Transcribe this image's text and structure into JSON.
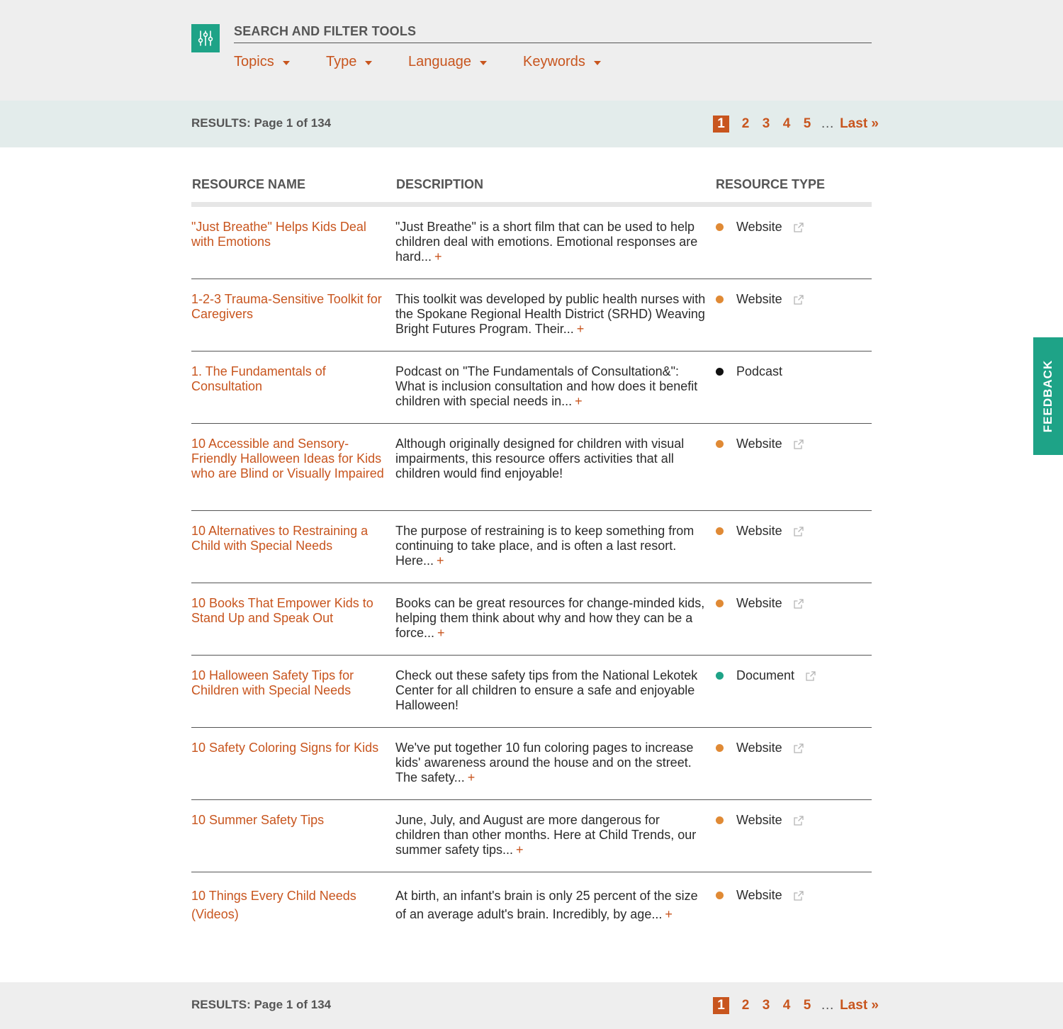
{
  "filters": {
    "heading": "SEARCH AND FILTER TOOLS",
    "menus": [
      {
        "label": "Topics"
      },
      {
        "label": "Type"
      },
      {
        "label": "Language"
      },
      {
        "label": "Keywords"
      }
    ]
  },
  "results": {
    "label": "RESULTS: Page 1 of 134",
    "pages": [
      "1",
      "2",
      "3",
      "4",
      "5"
    ],
    "current_page": "1",
    "ellipsis": "…",
    "last_label": "Last »"
  },
  "table": {
    "headers": {
      "name": "RESOURCE NAME",
      "description": "DESCRIPTION",
      "type": "RESOURCE TYPE"
    },
    "more_symbol": "+",
    "rows": [
      {
        "name": "\"Just Breathe\" Helps Kids Deal with Emotions",
        "description": "\"Just Breathe\" is a short film that can be used to help children deal with emotions. Emotional responses are hard...",
        "more": "+",
        "type": "Website",
        "dot_color": "#e08a35",
        "external": true
      },
      {
        "name": "1-2-3 Trauma-Sensitive Toolkit for Caregivers",
        "description": "This toolkit was developed by public health nurses with the Spokane Regional Health District (SRHD) Weaving Bright Futures Program. Their...",
        "more": "+",
        "type": "Website",
        "dot_color": "#e08a35",
        "external": true
      },
      {
        "name": "1. The Fundamentals of Consultation",
        "description": "Podcast on \"The Fundamentals of Consultation&\": What is inclusion consultation and how does it benefit children with special needs in...",
        "more": "+",
        "type": "Podcast",
        "dot_color": "#111111",
        "external": false
      },
      {
        "name": "10 Accessible and Sensory-Friendly Halloween Ideas for Kids who are Blind or Visually Impaired",
        "description": "Although originally designed for children with visual impairments, this resource offers activities that all children would find enjoyable!",
        "more": "",
        "type": "Website",
        "dot_color": "#e08a35",
        "external": true
      },
      {
        "name": "10 Alternatives to Restraining a Child with Special Needs",
        "description": "The purpose of restraining is to keep something from continuing to take place, and is often a last resort. Here...",
        "more": "+",
        "type": "Website",
        "dot_color": "#e08a35",
        "external": true
      },
      {
        "name": "10 Books That Empower Kids to Stand Up and Speak Out",
        "description": "Books can be great resources for change-minded kids, helping them think about why and how they can be a force...",
        "more": "+",
        "type": "Website",
        "dot_color": "#e08a35",
        "external": true
      },
      {
        "name": "10 Halloween Safety Tips for Children with Special Needs",
        "description": "Check out these safety tips from the National Lekotek Center for all children to ensure a safe and enjoyable Halloween!",
        "more": "",
        "type": "Document",
        "dot_color": "#1ea387",
        "external": true
      },
      {
        "name": "10 Safety Coloring Signs for Kids",
        "description": "We've put together 10 fun coloring pages to increase kids' awareness around the house and on the street. The safety...",
        "more": "+",
        "type": "Website",
        "dot_color": "#e08a35",
        "external": true
      },
      {
        "name": "10 Summer Safety Tips",
        "description": "June, July, and August are more dangerous for children than other months. Here at Child Trends, our summer safety tips...",
        "more": "+",
        "type": "Website",
        "dot_color": "#e08a35",
        "external": true
      },
      {
        "name": "10 Things Every Child Needs (Videos)",
        "description": "At birth, an infant's brain is only 25 percent of the size of an average adult's brain. Incredibly, by age...",
        "more": "+",
        "type": "Website",
        "dot_color": "#e08a35",
        "external": true
      }
    ]
  },
  "feedback": {
    "label": "FEEDBACK"
  },
  "colors": {
    "accent": "#c8551e",
    "brand": "#1ea387",
    "website_dot": "#e08a35",
    "podcast_dot": "#111111",
    "document_dot": "#1ea387"
  }
}
